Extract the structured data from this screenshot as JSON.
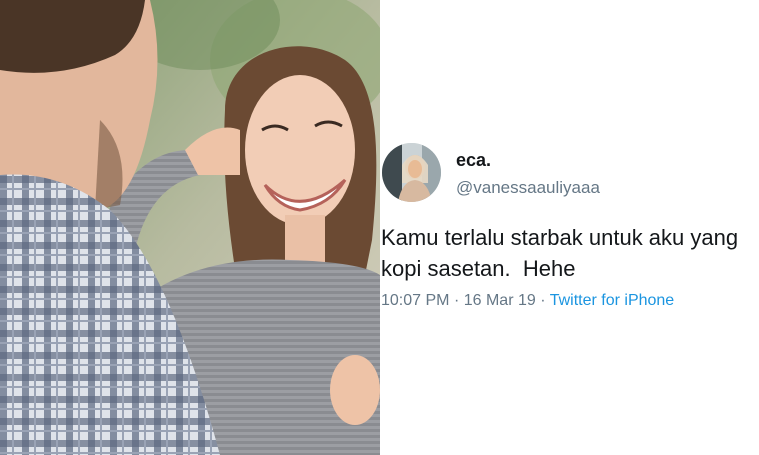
{
  "photo": {
    "description_icon": "couple-photo"
  },
  "tweet": {
    "display_name": "eca.",
    "handle": "@vanessaauliyaaa",
    "text_line1": "Kamu terlalu starbak untuk aku yang",
    "text_line2": "kopi sasetan.  Hehe",
    "time": "10:07 PM",
    "separator": "·",
    "date": "16 Mar 19",
    "source": "Twitter for iPhone"
  },
  "colors": {
    "text_primary": "#14171a",
    "text_secondary": "#657786",
    "link": "#1b95e0",
    "background": "#ffffff"
  }
}
